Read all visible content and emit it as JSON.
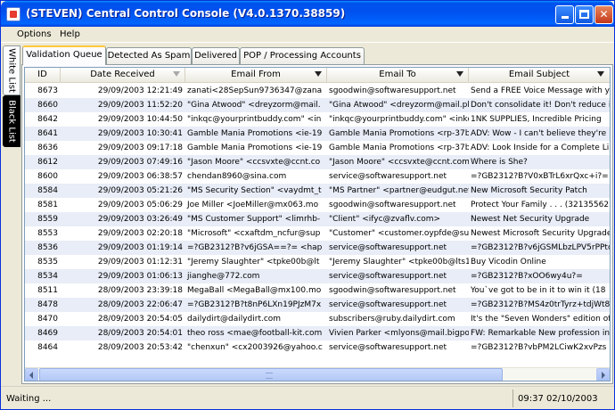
{
  "window": {
    "title": "(STEVEN) Central Control Console (V4.0.1370.38859)"
  },
  "menu": {
    "items": [
      "Options",
      "Help"
    ]
  },
  "side_tabs": {
    "white_list": "White List",
    "black_list": "Black List"
  },
  "tabs": [
    "Validation Queue",
    "Detected As Spam",
    "Delivered",
    "POP / Processing Accounts"
  ],
  "active_tab": "Validation Queue",
  "grid": {
    "columns": [
      "ID",
      "Date Received",
      "Email From",
      "Email To",
      "Email Subject"
    ],
    "rows": [
      [
        "8673",
        "29/09/2003 12:21:49",
        "zanati<28SepSun9736347@zana",
        "sgoodwin@softwaresupport.net",
        "Send a FREE Voice Message with y"
      ],
      [
        "8660",
        "29/09/2003 11:52:20",
        "\"Gina Atwood\" <dreyzorm@mail.",
        "\"Gina Atwood\" <dreyzorm@mail.pl",
        "Don't consolidate it! Don't reduce it"
      ],
      [
        "8642",
        "29/09/2003 10:44:50",
        "\"inkqc@yourprintbuddy.com\" <in",
        "\"inkqc@yourprintbuddy.com\" <inkq",
        "1NK SUPPLIES, Incredible Pricing"
      ],
      [
        "8641",
        "29/09/2003 10:30:41",
        "Gamble Mania Promotions <ie-19",
        "Gamble Mania Promotions <rp-37b",
        "ADV: Wow - I can't believe they're"
      ],
      [
        "8636",
        "29/09/2003 09:17:18",
        "Gamble Mania Promotions <ie-19",
        "Gamble Mania Promotions <rp-37b",
        "ADV: Look Inside for a Complete Li"
      ],
      [
        "8612",
        "29/09/2003 07:49:16",
        "\"Jason Moore\" <ccsvxte@ccnt.co",
        "\"Jason Moore\" <ccsvxte@ccnt.com.",
        "Where is She?"
      ],
      [
        "8600",
        "29/09/2003 06:38:57",
        "chendan8960@sina.com",
        "service@softwaresupport.net",
        "=?GB2312?B?V0xBTrL6xrQxc+i?="
      ],
      [
        "8584",
        "29/09/2003 05:21:26",
        "\"MS Security Section\" <vaydmt_t",
        "\"MS Partner\" <partner@eudgut.net",
        "New Microsoft Security Patch"
      ],
      [
        "8581",
        "29/09/2003 05:06:29",
        "Joe Miller <JoeMiller@mx063.mo",
        "sgoodwin@softwaresupport.net",
        "Protect Your Family . . . (32135562"
      ],
      [
        "8559",
        "29/09/2003 03:26:49",
        "\"MS Customer Support\" <limrhb-",
        "\"Client\" <ifyc@zvaflv.com>",
        "Newest Net Security Upgrade"
      ],
      [
        "8553",
        "29/09/2003 02:20:18",
        "\"Microsoft\" <cxaftdm_ncfur@sup",
        "\"Customer\" <customer.oypfde@su",
        "Newest Microsoft Security Upgrade"
      ],
      [
        "8536",
        "29/09/2003 01:19:14",
        "=?GB2312?B?v6jGSA==?= <hap",
        "service@softwaresupport.net",
        "=?GB2312?B?v6jGSMLbzLPV5rPPtc"
      ],
      [
        "8535",
        "29/09/2003 01:12:31",
        "\"Jeremy Slaughter\" <tpke00b@lt",
        "\"Jeremy Slaughter\" <tpke00b@lts1",
        "Buy Vicodin Online"
      ],
      [
        "8534",
        "29/09/2003 01:06:13",
        "jianghe@772.com",
        "service@softwaresupport.net",
        "=?GB2312?B?xOO6wy4u?="
      ],
      [
        "8511",
        "28/09/2003 23:39:18",
        "MegaBall <MegaBall@mx100.mo",
        "sgoodwin@softwaresupport.net",
        "You`ve got to be in it to win it (18"
      ],
      [
        "8478",
        "28/09/2003 22:06:47",
        "=?GB2312?B?t8nP6LXn19PJzM7x",
        "service@softwaresupport.net",
        "=?GB2312?B?MS4z0trTyrz+tdjWt8j"
      ],
      [
        "8470",
        "28/09/2003 20:54:05",
        "dailydirt@dailydirt.com",
        "subscribers@ruby.dailydirt.com",
        "It's the \"Seven Wonders\" edition of"
      ],
      [
        "8469",
        "28/09/2003 20:54:01",
        "theo ross <mae@football-kit.com",
        "Vivien Parker <mlyons@mail.bigpo",
        "FW: Remarkable New profession in"
      ],
      [
        "8464",
        "28/09/2003 20:53:42",
        "\"chenxun\" <cx2003926@yahoo.c",
        "service@softwaresupport.net",
        "=?GB2312?B?vbPM2LCiwK2xvPzs"
      ]
    ]
  },
  "status": {
    "left": "Waiting ...",
    "right": "09:37 02/10/2003"
  },
  "colors": {
    "titlebar": "#0054e3",
    "row_alt": "#e8edf7",
    "tab_active_accent": "#ffc83c"
  }
}
